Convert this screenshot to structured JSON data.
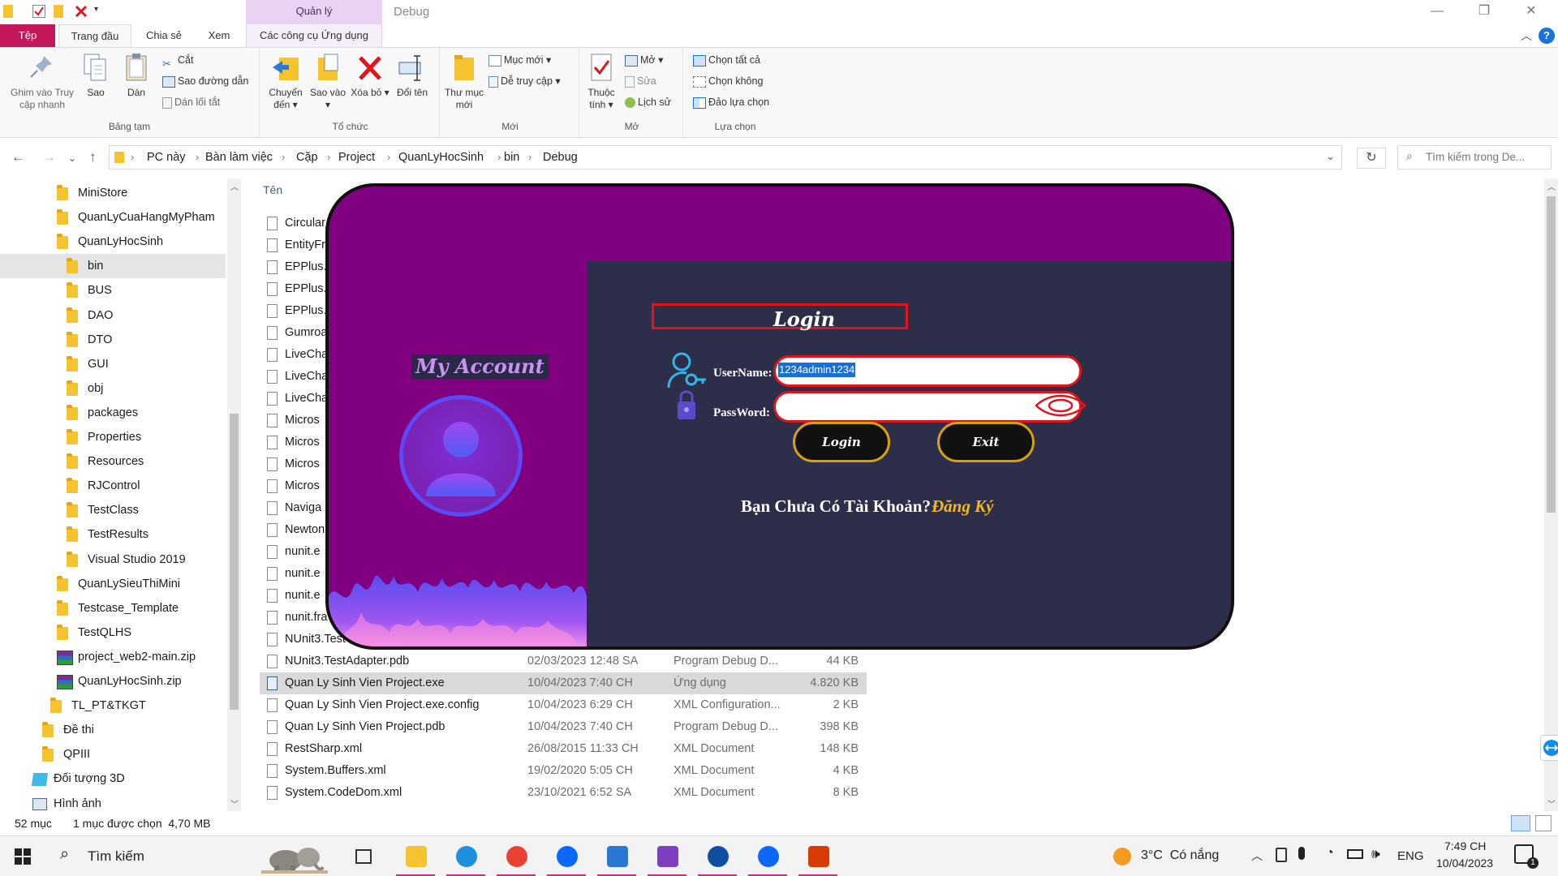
{
  "titlebar": {
    "context_tab_group": "Quản lý",
    "window_title": "Debug"
  },
  "tabs": {
    "file": "Tệp",
    "home": "Trang đầu",
    "share": "Chia sẻ",
    "view": "Xem",
    "app_tools": "Các công cụ Ứng dụng"
  },
  "ribbon": {
    "clipboard": {
      "label": "Bảng tạm",
      "pin": "Ghim vào Truy cập nhanh",
      "copy": "Sao",
      "paste": "Dán",
      "cut": "Cắt",
      "copy_path": "Sao đường dẫn",
      "paste_shortcut": "Dán lối tắt"
    },
    "organize": {
      "label": "Tổ chức",
      "move_to": "Chuyển đến",
      "copy_to": "Sao vào",
      "delete": "Xóa bỏ",
      "rename": "Đổi tên"
    },
    "new": {
      "label": "Mới",
      "new_folder": "Thư mục mới",
      "new_item": "Mục mới",
      "easy_access": "Dễ truy cập"
    },
    "open": {
      "label": "Mở",
      "properties": "Thuộc tính",
      "open": "Mở",
      "edit": "Sửa",
      "history": "Lịch sử"
    },
    "select": {
      "label": "Lựa chọn",
      "select_all": "Chọn tất cả",
      "select_none": "Chọn không",
      "invert": "Đảo lựa chọn"
    }
  },
  "address": {
    "crumbs": [
      "PC này",
      "Bàn làm việc",
      "Cặp",
      "Project",
      "QuanLyHocSinh",
      "bin",
      "Debug"
    ],
    "search_placeholder": "Tìm kiếm trong De..."
  },
  "nav": {
    "items": [
      {
        "label": "MiniStore",
        "type": "folder"
      },
      {
        "label": "QuanLyCuaHangMyPham",
        "type": "folder"
      },
      {
        "label": "QuanLyHocSinh",
        "type": "folder"
      },
      {
        "label": "bin",
        "type": "folder",
        "selected": true
      },
      {
        "label": "BUS",
        "type": "folder"
      },
      {
        "label": "DAO",
        "type": "folder"
      },
      {
        "label": "DTO",
        "type": "folder"
      },
      {
        "label": "GUI",
        "type": "folder"
      },
      {
        "label": "obj",
        "type": "folder"
      },
      {
        "label": "packages",
        "type": "folder"
      },
      {
        "label": "Properties",
        "type": "folder"
      },
      {
        "label": "Resources",
        "type": "folder"
      },
      {
        "label": "RJControl",
        "type": "folder"
      },
      {
        "label": "TestClass",
        "type": "folder"
      },
      {
        "label": "TestResults",
        "type": "folder"
      },
      {
        "label": "Visual Studio 2019",
        "type": "folder"
      },
      {
        "label": "QuanLySieuThiMini",
        "type": "folder"
      },
      {
        "label": "Testcase_Template",
        "type": "folder"
      },
      {
        "label": "TestQLHS",
        "type": "folder"
      },
      {
        "label": "project_web2-main.zip",
        "type": "zip"
      },
      {
        "label": "QuanLyHocSinh.zip",
        "type": "zip"
      },
      {
        "label": "TL_PT&TKGT",
        "type": "folder"
      },
      {
        "label": "Đề thi",
        "type": "folder"
      },
      {
        "label": "QPIII",
        "type": "folder"
      },
      {
        "label": "Đối tượng 3D",
        "type": "obj3d"
      },
      {
        "label": "Hình ảnh",
        "type": "pictures"
      }
    ]
  },
  "filelist": {
    "column_name": "Tên",
    "partial_rows": [
      "Circular",
      "EntityFr",
      "EPPlus.",
      "EPPlus.",
      "EPPlus.",
      "Gumroa",
      "LiveCha",
      "LiveCha",
      "LiveCha",
      "Micros",
      "Micros",
      "Micros",
      "Micros",
      "Naviga",
      "Newton",
      "nunit.e",
      "nunit.e",
      "nunit.e",
      "nunit.fra",
      "NUnit3.Test"
    ],
    "rows": [
      {
        "name": "NUnit3.TestAdapter.pdb",
        "date": "02/03/2023 12:48 SA",
        "type": "Program Debug D...",
        "size": "44 KB"
      },
      {
        "name": "Quan Ly Sinh Vien Project.exe",
        "date": "10/04/2023 7:40 CH",
        "type": "Ứng dụng",
        "size": "4.820 KB",
        "selected": true,
        "exe": true
      },
      {
        "name": "Quan Ly Sinh Vien Project.exe.config",
        "date": "10/04/2023 6:29 CH",
        "type": "XML Configuration...",
        "size": "2 KB"
      },
      {
        "name": "Quan Ly Sinh Vien Project.pdb",
        "date": "10/04/2023 7:40 CH",
        "type": "Program Debug D...",
        "size": "398 KB"
      },
      {
        "name": "RestSharp.xml",
        "date": "26/08/2015 11:33 CH",
        "type": "XML Document",
        "size": "148 KB"
      },
      {
        "name": "System.Buffers.xml",
        "date": "19/02/2020 5:05 CH",
        "type": "XML Document",
        "size": "4 KB"
      },
      {
        "name": "System.CodeDom.xml",
        "date": "23/10/2021 6:52 SA",
        "type": "XML Document",
        "size": "8 KB"
      }
    ]
  },
  "status": {
    "count": "52 mục",
    "selection": "1 mục được chọn  4,70 MB"
  },
  "login": {
    "my_account": "My Account",
    "title": "Login",
    "username_label": "UserName:",
    "username_value": "1234admin1234",
    "password_label": "PassWord:",
    "login_button": "Login",
    "exit_button": "Exit",
    "no_account": "Bạn Chưa Có Tài Khoản?",
    "register": "Đăng Ký"
  },
  "taskbar": {
    "search": "Tìm kiếm",
    "weather": "3°C  Có nắng",
    "lang": "ENG",
    "time": "7:49 CH",
    "date": "10/04/2023",
    "notification_count": "1",
    "apps": [
      "task-view",
      "file-explorer",
      "edge",
      "chrome",
      "zalo",
      "photos",
      "visual-studio",
      "teamviewer",
      "zalo-call",
      "office"
    ]
  },
  "colors": {
    "file_tab": "#c2185b",
    "dialog_purple": "#800080",
    "dialog_panel": "#2d2e49",
    "input_border": "#e0141a",
    "button_border": "#d4a017",
    "register_text": "#f5b919"
  }
}
